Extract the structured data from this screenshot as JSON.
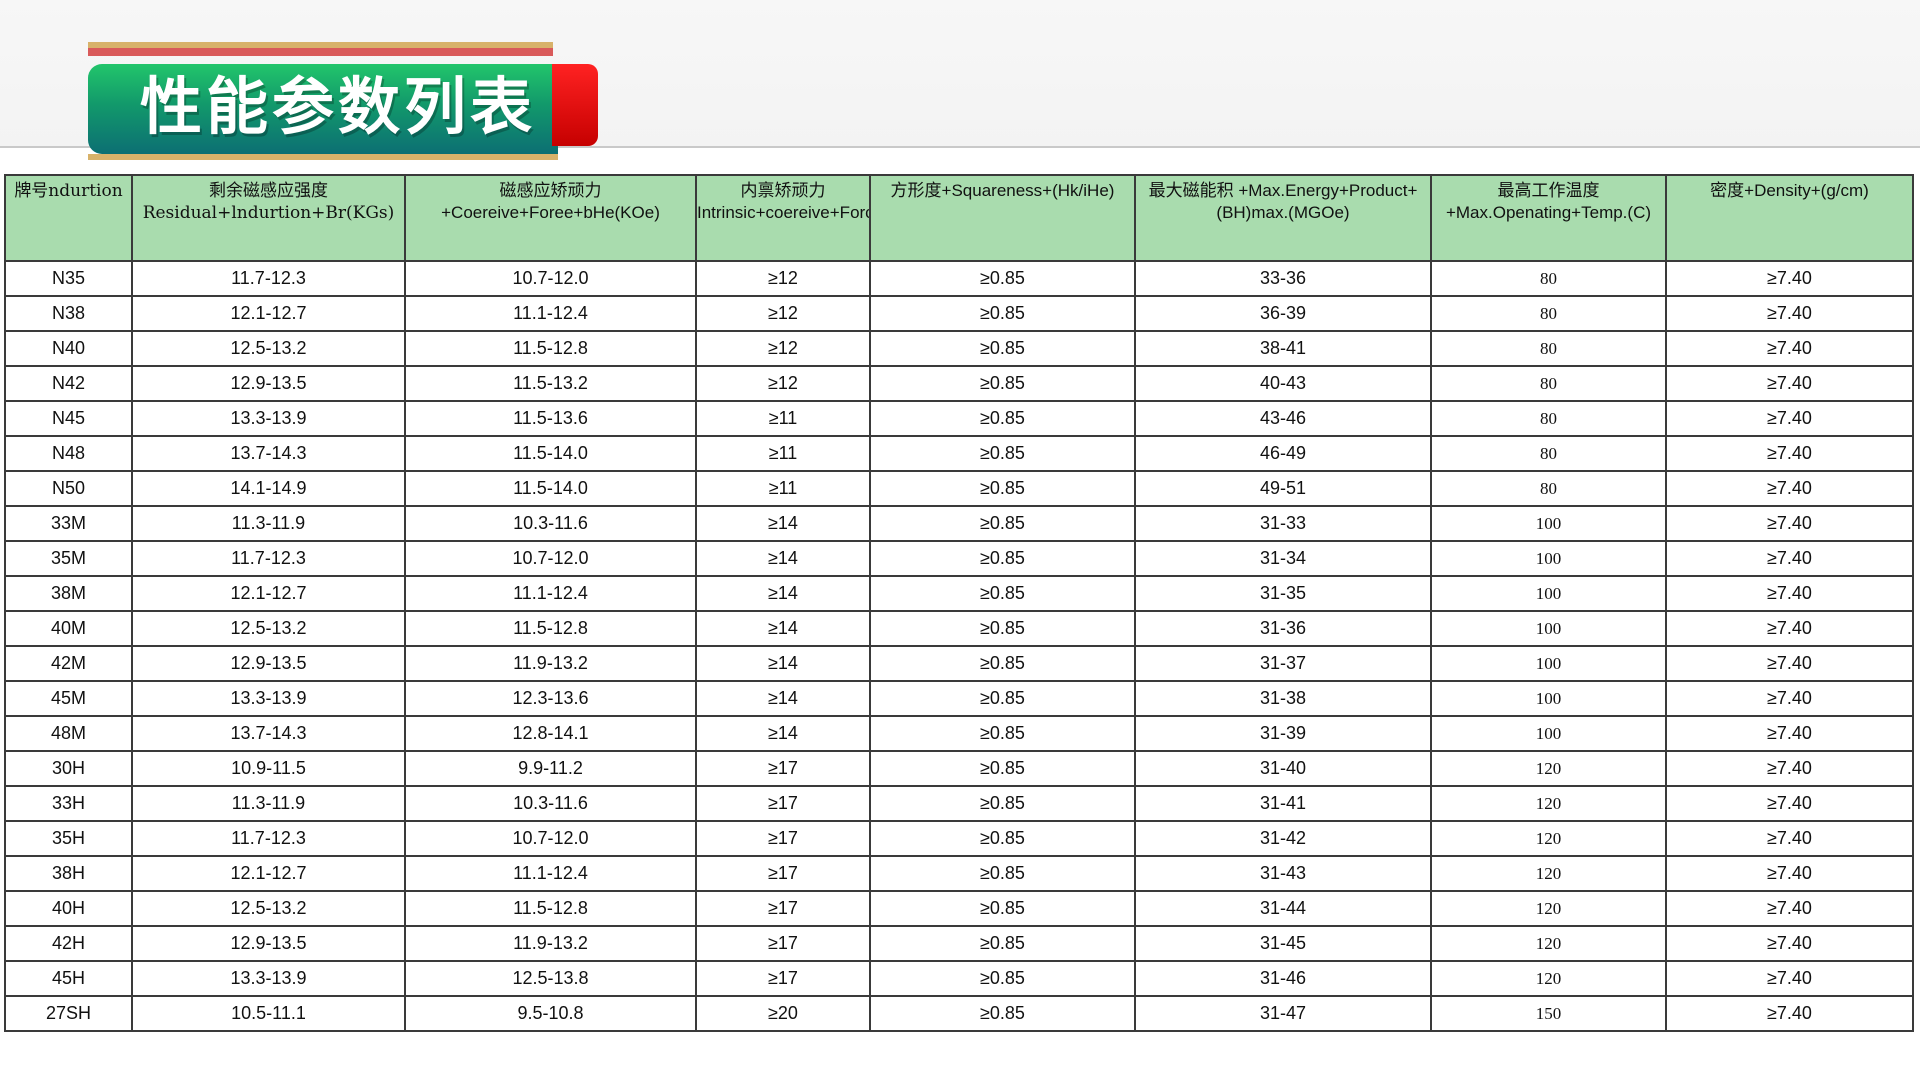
{
  "page": {
    "title": "性能参数列表"
  },
  "table": {
    "headers": [
      "牌号ndurtion",
      "剩余磁感应强度 Residual+lndurtion+Br(KGs)",
      "磁感应矫顽力 +Coereive+Foree+bHe(KOe)",
      "内禀矫顽力 Intrinsic+coereive+Force+iGe(KOe)",
      "方形度+Squareness+(Hk/iHe)",
      "最大磁能积 +Max.Energy+Product+(BH)max.(MGOe)",
      "最高工作温度 +Max.Openating+Temp.(C)",
      "密度+Density+(g/cm)"
    ],
    "rows": [
      [
        "N35",
        "11.7-12.3",
        "10.7-12.0",
        "≥12",
        "≥0.85",
        "33-36",
        "80",
        "≥7.40"
      ],
      [
        "N38",
        "12.1-12.7",
        "11.1-12.4",
        "≥12",
        "≥0.85",
        "36-39",
        "80",
        "≥7.40"
      ],
      [
        "N40",
        "12.5-13.2",
        "11.5-12.8",
        "≥12",
        "≥0.85",
        "38-41",
        "80",
        "≥7.40"
      ],
      [
        "N42",
        "12.9-13.5",
        "11.5-13.2",
        "≥12",
        "≥0.85",
        "40-43",
        "80",
        "≥7.40"
      ],
      [
        "N45",
        "13.3-13.9",
        "11.5-13.6",
        "≥11",
        "≥0.85",
        "43-46",
        "80",
        "≥7.40"
      ],
      [
        "N48",
        "13.7-14.3",
        "11.5-14.0",
        "≥11",
        "≥0.85",
        "46-49",
        "80",
        "≥7.40"
      ],
      [
        "N50",
        "14.1-14.9",
        "11.5-14.0",
        "≥11",
        "≥0.85",
        "49-51",
        "80",
        "≥7.40"
      ],
      [
        "33M",
        "11.3-11.9",
        "10.3-11.6",
        "≥14",
        "≥0.85",
        "31-33",
        "100",
        "≥7.40"
      ],
      [
        "35M",
        "11.7-12.3",
        "10.7-12.0",
        "≥14",
        "≥0.85",
        "31-34",
        "100",
        "≥7.40"
      ],
      [
        "38M",
        "12.1-12.7",
        "11.1-12.4",
        "≥14",
        "≥0.85",
        "31-35",
        "100",
        "≥7.40"
      ],
      [
        "40M",
        "12.5-13.2",
        "11.5-12.8",
        "≥14",
        "≥0.85",
        "31-36",
        "100",
        "≥7.40"
      ],
      [
        "42M",
        "12.9-13.5",
        "11.9-13.2",
        "≥14",
        "≥0.85",
        "31-37",
        "100",
        "≥7.40"
      ],
      [
        "45M",
        "13.3-13.9",
        "12.3-13.6",
        "≥14",
        "≥0.85",
        "31-38",
        "100",
        "≥7.40"
      ],
      [
        "48M",
        "13.7-14.3",
        "12.8-14.1",
        "≥14",
        "≥0.85",
        "31-39",
        "100",
        "≥7.40"
      ],
      [
        "30H",
        "10.9-11.5",
        "9.9-11.2",
        "≥17",
        "≥0.85",
        "31-40",
        "120",
        "≥7.40"
      ],
      [
        "33H",
        "11.3-11.9",
        "10.3-11.6",
        "≥17",
        "≥0.85",
        "31-41",
        "120",
        "≥7.40"
      ],
      [
        "35H",
        "11.7-12.3",
        "10.7-12.0",
        "≥17",
        "≥0.85",
        "31-42",
        "120",
        "≥7.40"
      ],
      [
        "38H",
        "12.1-12.7",
        "11.1-12.4",
        "≥17",
        "≥0.85",
        "31-43",
        "120",
        "≥7.40"
      ],
      [
        "40H",
        "12.5-13.2",
        "11.5-12.8",
        "≥17",
        "≥0.85",
        "31-44",
        "120",
        "≥7.40"
      ],
      [
        "42H",
        "12.9-13.5",
        "11.9-13.2",
        "≥17",
        "≥0.85",
        "31-45",
        "120",
        "≥7.40"
      ],
      [
        "45H",
        "13.3-13.9",
        "12.5-13.8",
        "≥17",
        "≥0.85",
        "31-46",
        "120",
        "≥7.40"
      ],
      [
        "27SH",
        "10.5-11.1",
        "9.5-10.8",
        "≥20",
        "≥0.85",
        "31-47",
        "150",
        "≥7.40"
      ]
    ]
  },
  "colors": {
    "header_bg": "#a9dcae",
    "banner_green_top": "#22c56b",
    "banner_green_bottom": "#0c6f73",
    "banner_red": "#e10000",
    "border": "#3a3a3a"
  }
}
